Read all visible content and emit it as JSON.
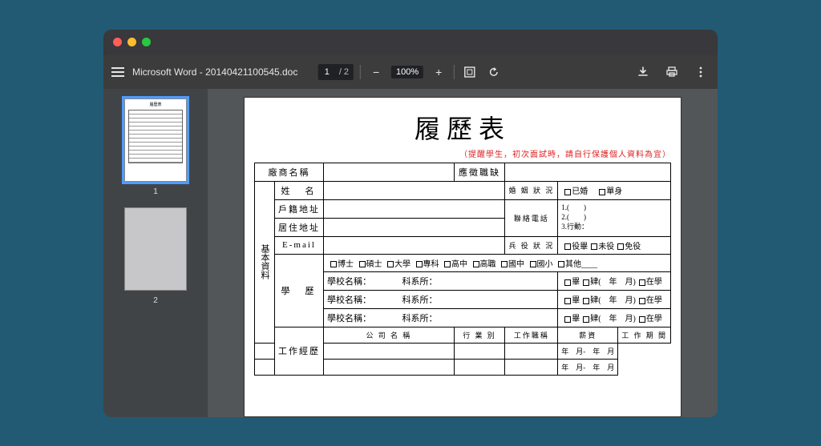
{
  "window": {
    "filename": "Microsoft Word - 20140421100545.doc"
  },
  "toolbar": {
    "currentPage": "1",
    "totalPages": "/ 2",
    "zoom": "100%"
  },
  "thumbs": {
    "p1": "1",
    "p2": "2"
  },
  "doc": {
    "title": "履歷表",
    "warn": "（提醒學生，初次面試時，請自行保護個人資料為宜）",
    "vendorLabel": "廠商名稱",
    "postLabel": "應徵職缺",
    "vhead": "基本資料",
    "nameLabel": "姓　名",
    "maritalLabel": "婚 姻 狀 況",
    "maritalOpts": {
      "married": "已婚",
      "single": "單身"
    },
    "regAddrLabel": "戶籍地址",
    "liveAddrLabel": "居住地址",
    "phoneLabel": "聯絡電話",
    "phoneLines": {
      "l1": "1.(　　)",
      "l2": "2.(　　)",
      "l3": "3.行動："
    },
    "emailLabel": "E-mail",
    "militaryLabel": "兵 役 狀 況",
    "militaryOpts": {
      "done": "役畢",
      "not": "未役",
      "exempt": "免役"
    },
    "eduLabel": "學　歷",
    "eduLevels": {
      "phd": "博士",
      "ms": "碩士",
      "uni": "大學",
      "col": "專科",
      "hs": "高中",
      "voc": "高職",
      "jh": "國中",
      "el": "國小",
      "other": "其他____"
    },
    "schoolLabel": "學校名稱：",
    "deptLabel": "科系所：",
    "gradOpts": {
      "grad": "畢",
      "undone": "肄"
    },
    "yearMonth": "(　年　月)",
    "enroll": "在學",
    "workLabel": "工作經歷",
    "th": {
      "company": "公 司 名 稱",
      "industry": "行 業 別",
      "title": "工作職稱",
      "salary": "薪資",
      "period": "工 作 期 間"
    },
    "periodFmt": "年　月-　年　月"
  }
}
